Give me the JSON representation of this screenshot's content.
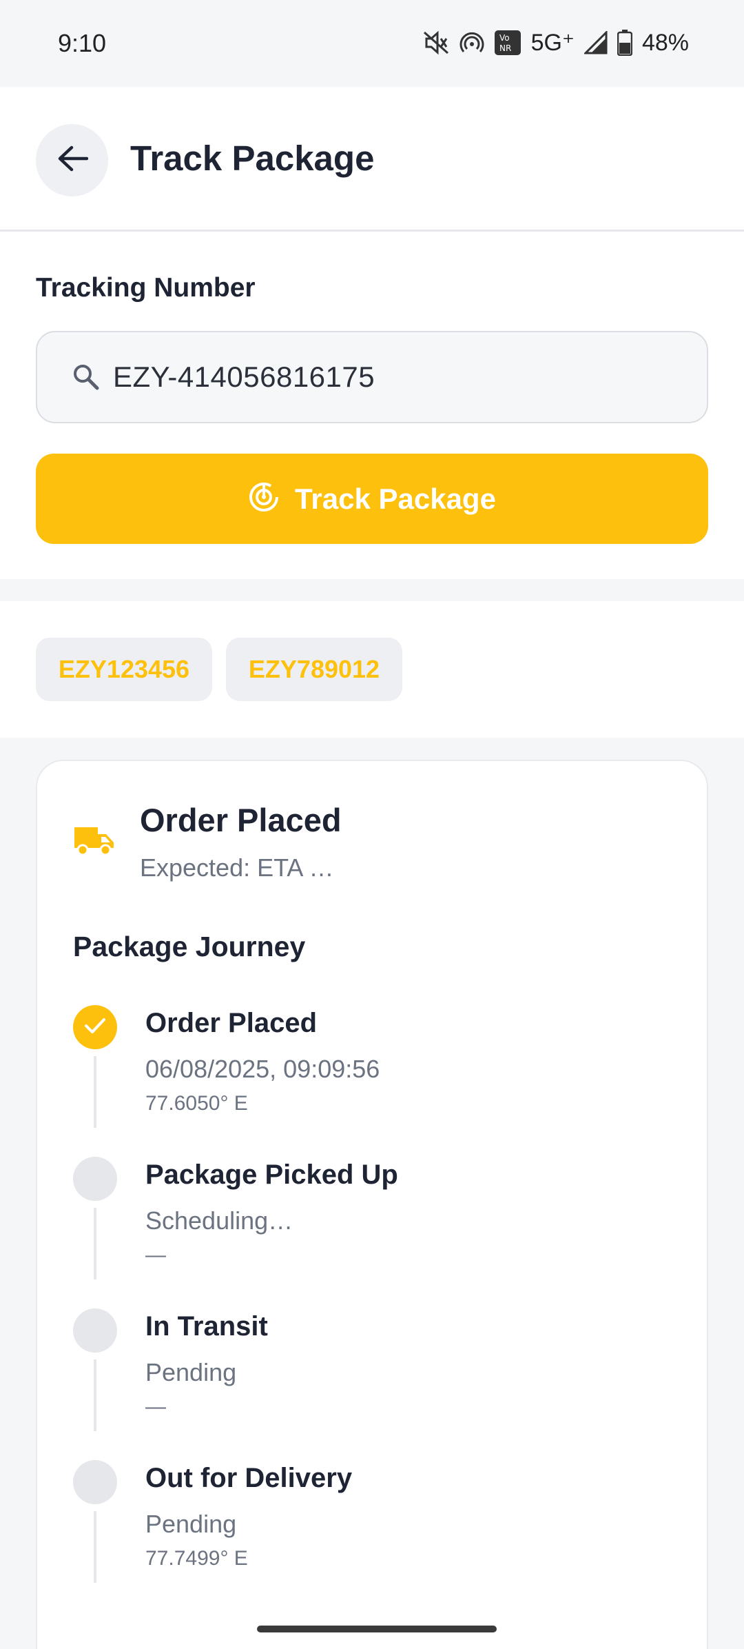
{
  "status_bar": {
    "time": "9:10",
    "network": "5G⁺",
    "battery": "48%",
    "icons": [
      "mute-icon",
      "hotspot-icon",
      "vonr-icon",
      "signal-icon",
      "battery-icon"
    ]
  },
  "header": {
    "title": "Track Package",
    "back_icon": "arrow-left-icon"
  },
  "search": {
    "label": "Tracking Number",
    "value": "EZY-414056816175",
    "button_label": "Track Package"
  },
  "recent_chips": [
    "EZY123456",
    "EZY789012"
  ],
  "card": {
    "status": "Order Placed",
    "eta": "Expected: ETA …",
    "journey_title": "Package Journey",
    "steps": [
      {
        "title": "Order Placed",
        "subtitle": "06/08/2025, 09:09:56",
        "detail": "77.6050° E",
        "done": true
      },
      {
        "title": "Package Picked Up",
        "subtitle": "Scheduling…",
        "detail": "—",
        "done": false
      },
      {
        "title": "In Transit",
        "subtitle": "Pending",
        "detail": "—",
        "done": false
      },
      {
        "title": "Out for Delivery",
        "subtitle": "Pending",
        "detail": "77.7499° E",
        "done": false
      }
    ]
  },
  "colors": {
    "accent": "#FDC10D",
    "text": "#1E2433",
    "muted": "#6B7280",
    "background": "#F5F6F8"
  }
}
